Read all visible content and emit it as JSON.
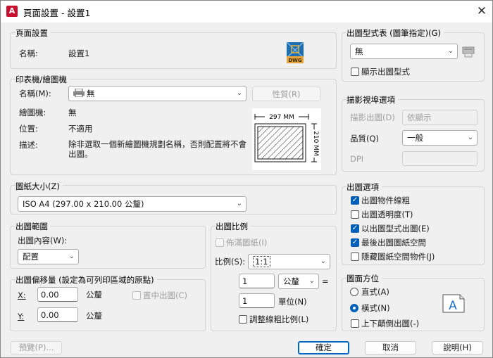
{
  "window": {
    "title": "頁面設置 - 設置1",
    "app_icon_letter": "A"
  },
  "page_setup": {
    "group": "頁面設置",
    "name_label": "名稱:",
    "name_value": "設置1",
    "file_badge": "DWG"
  },
  "printer": {
    "group": "印表機/繪圖機",
    "name_label": "名稱(M):",
    "name_value": "無",
    "properties_button": "性質(R)",
    "plotter_label": "繪圖機:",
    "plotter_value": "無",
    "location_label": "位置:",
    "location_value": "不適用",
    "desc_label": "描述:",
    "desc_value": "除非選取一個新繪圖機規劃名稱，否則配置將不會出圖。",
    "preview_width": "297 MM",
    "preview_height": "210 MM"
  },
  "paper_size": {
    "group": "圖紙大小(Z)",
    "value": "ISO A4 (297.00 x 210.00 公釐)"
  },
  "plot_area": {
    "group": "出圖範圍",
    "what_label": "出圖內容(W):",
    "what_value": "配置"
  },
  "plot_offset": {
    "group": "出圖偏移量 (設定為可列印區域的原點)",
    "x_label": "X:",
    "x_value": "0.00",
    "x_unit": "公釐",
    "y_label": "Y:",
    "y_value": "0.00",
    "y_unit": "公釐",
    "center_label": "置中出圖(C)"
  },
  "plot_scale": {
    "group": "出圖比例",
    "fit_label": "佈滿圖紙(I)",
    "scale_label": "比例(S):",
    "scale_value": "1:1",
    "num_value": "1",
    "num_unit": "公釐",
    "equals": "=",
    "den_value": "1",
    "den_unit": "單位(N)",
    "lineweights_label": "調整線粗比例(L)"
  },
  "plot_style": {
    "group": "出圖型式表 (圖筆指定)(G)",
    "value": "無",
    "display_label": "顯示出圖型式"
  },
  "shaded": {
    "group": "描影視埠選項",
    "shade_label": "描影出圖(D)",
    "shade_value": "依顯示",
    "quality_label": "品質(Q)",
    "quality_value": "一般",
    "dpi_label": "DPI"
  },
  "plot_options": {
    "group": "出圖選項",
    "items": [
      {
        "label": "出圖物件線粗",
        "checked": true
      },
      {
        "label": "出圖透明度(T)",
        "checked": false
      },
      {
        "label": "以出圖型式出圖(E)",
        "checked": true
      },
      {
        "label": "最後出圖圖紙空間",
        "checked": true
      },
      {
        "label": "隱藏圖紙空間物件(J)",
        "checked": false
      }
    ]
  },
  "orientation": {
    "group": "圖面方位",
    "portrait": "直式(A)",
    "landscape": "橫式(N)",
    "upside_down": "上下顛倒出圖(-)",
    "icon_letter": "A"
  },
  "footer": {
    "preview": "預覽(P)...",
    "ok": "確定",
    "cancel": "取消",
    "help": "說明(H)"
  },
  "colors": {
    "accent": "#005fb8",
    "app_icon": "#c8102e"
  }
}
